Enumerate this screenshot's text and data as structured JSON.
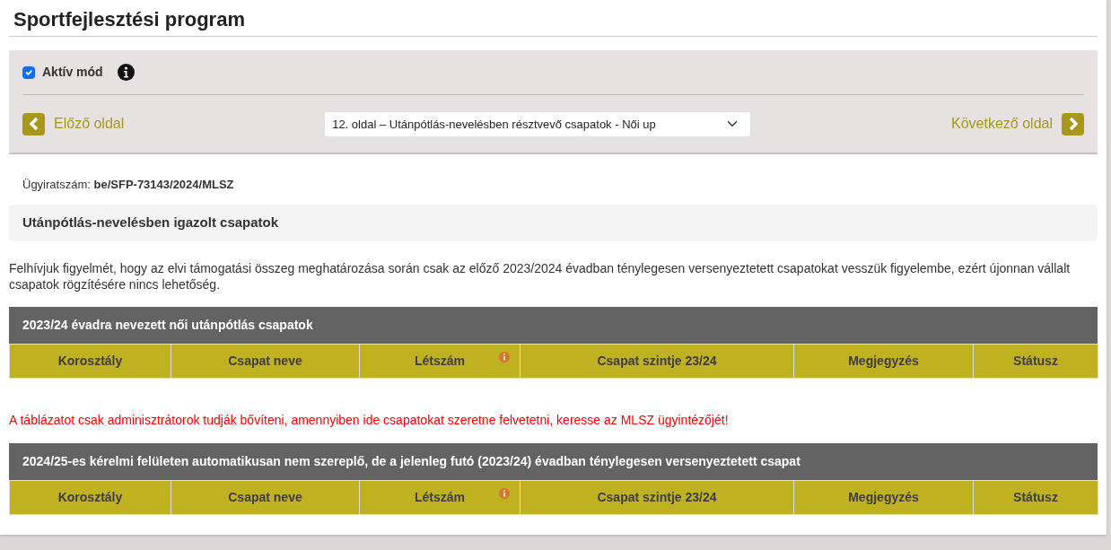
{
  "title": "Sportfejlesztési program",
  "active_mode": {
    "label": "Aktív mód",
    "checked": true
  },
  "nav": {
    "prev": "Előző oldal",
    "page_select": "12. oldal – Utánpótlás-nevelésben résztvevő csapatok - Női up",
    "next": "Következő oldal"
  },
  "case_number": {
    "label": "Ügyiratszám:",
    "value": "be/SFP-73143/2024/MLSZ"
  },
  "section_title": "Utánpótlás-nevelésben igazolt csapatok",
  "notice": "Felhívjuk figyelmét, hogy az elvi támogatási összeg meghatározása során csak az előző 2023/2024 évadban ténylegesen versenyeztetett csapatokat vesszük figyelembe, ezért újonnan vállalt csapatok rögzítésére nincs lehetőség.",
  "content": [
    {
      "kind": "table",
      "title": "2023/24 évadra nevezett női utánpótlás csapatok",
      "columns": [
        {
          "label": "Korosztály",
          "info": false
        },
        {
          "label": "Csapat neve",
          "info": false
        },
        {
          "label": "Létszám",
          "info": true
        },
        {
          "label": "Csapat szintje 23/24",
          "info": false
        },
        {
          "label": "Megjegyzés",
          "info": false
        },
        {
          "label": "Státusz",
          "info": false
        }
      ]
    },
    {
      "kind": "warning",
      "text": "A táblázatot csak adminisztrátorok tudják bővíteni, amennyiben ide csapatokat szeretne felvetetni, keresse az MLSZ ügyintézőjét!"
    },
    {
      "kind": "table",
      "title": "2024/25-es kérelmi felületen automatikusan nem szereplő, de a jelenleg futó (2023/24) évadban ténylegesen versenyeztetett csapat",
      "columns": [
        {
          "label": "Korosztály",
          "info": false
        },
        {
          "label": "Csapat neve",
          "info": false
        },
        {
          "label": "Létszám",
          "info": true
        },
        {
          "label": "Csapat szintje 23/24",
          "info": false
        },
        {
          "label": "Megjegyzés",
          "info": false
        },
        {
          "label": "Státusz",
          "info": false
        }
      ]
    }
  ]
}
